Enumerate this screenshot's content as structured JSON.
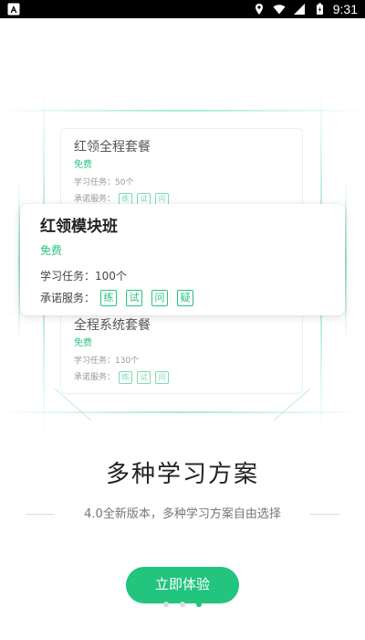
{
  "status_bar": {
    "time": "9:31",
    "icons": [
      "app-notification-icon",
      "location-icon",
      "wifi-icon",
      "signal-icon",
      "battery-icon"
    ]
  },
  "cards": {
    "back_top": {
      "title": "红领全程套餐",
      "price": "免费",
      "tasks": "学习任务：50个",
      "service_label": "承诺服务：",
      "tags": [
        "练",
        "试",
        "问"
      ]
    },
    "front": {
      "title": "红领模块班",
      "price": "免费",
      "tasks": "学习任务：100个",
      "service_label": "承诺服务：",
      "tags": [
        "练",
        "试",
        "问",
        "疑"
      ]
    },
    "back_bottom": {
      "title": "全程系统套餐",
      "price": "免费",
      "tasks": "学习任务：130个",
      "service_label": "承诺服务：",
      "tags": [
        "练",
        "试",
        "问"
      ]
    }
  },
  "headline": "多种学习方案",
  "subtitle": "4.0全新版本，多种学习方案自由选择",
  "cta_label": "立即体验",
  "pager": {
    "count": 3,
    "active": 3
  },
  "colors": {
    "accent": "#22c47e",
    "accent_light": "#7bdcb1",
    "status_bar": "#000000"
  }
}
